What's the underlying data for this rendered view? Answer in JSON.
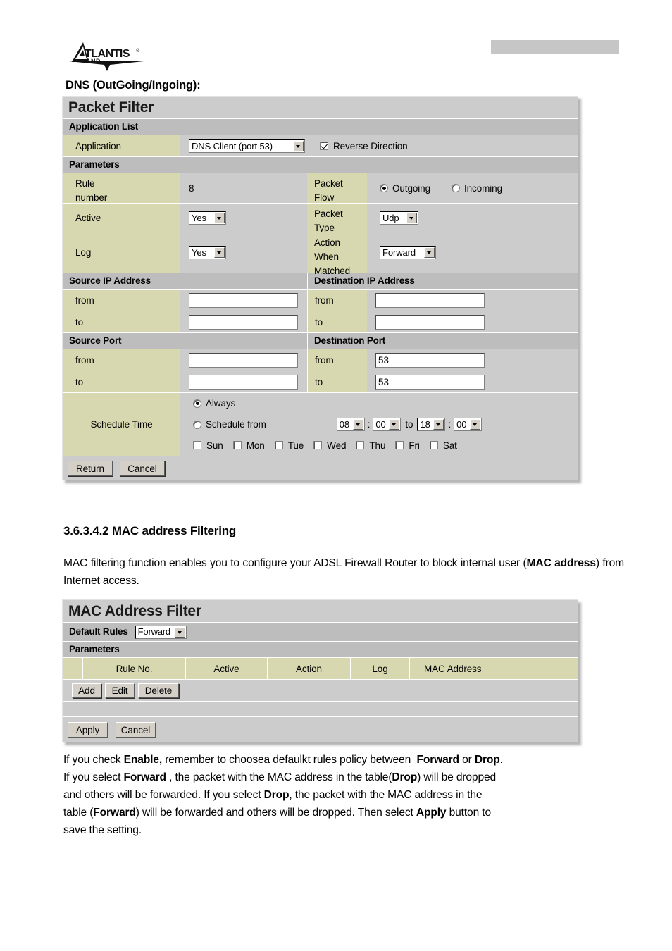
{
  "header": {
    "logo_alt": "Atlantis Land",
    "logo_primary": "TLANTIS",
    "logo_secondary": "AND",
    "logo_registered": "®"
  },
  "dns_caption": "DNS (OutGoing/Ingoing):",
  "packet_filter": {
    "title": "Packet Filter",
    "application_list_bar": "Application List",
    "application_label": "Application",
    "application_value": "DNS Client (port 53)",
    "reverse_direction_label": "Reverse Direction",
    "reverse_direction_checked": true,
    "parameters_bar": "Parameters",
    "rule_number_label": "Rule number",
    "rule_number_value": "8",
    "packet_flow_label": "Packet Flow",
    "packet_flow_outgoing": "Outgoing",
    "packet_flow_incoming": "Incoming",
    "packet_flow_selected": "Outgoing",
    "active_label": "Active",
    "active_value": "Yes",
    "packet_type_label": "Packet Type",
    "packet_type_value": "Udp",
    "log_label": "Log",
    "log_value": "Yes",
    "action_when_matched_label": "Action When Matched",
    "action_when_matched_value": "Forward",
    "source_ip_bar": "Source IP Address",
    "destination_ip_bar": "Destination IP Address",
    "source_ip_from_label": "from",
    "source_ip_from_value": "",
    "source_ip_to_label": "to",
    "source_ip_to_value": "",
    "dest_ip_from_label": "from",
    "dest_ip_from_value": "",
    "dest_ip_to_label": "to",
    "dest_ip_to_value": "",
    "source_port_bar": "Source Port",
    "destination_port_bar": "Destination Port",
    "source_port_from_label": "from",
    "source_port_from_value": "",
    "source_port_to_label": "to",
    "source_port_to_value": "",
    "dest_port_from_label": "from",
    "dest_port_from_value": "53",
    "dest_port_to_label": "to",
    "dest_port_to_value": "53",
    "schedule_time_label": "Schedule Time",
    "always_label": "Always",
    "always_selected": true,
    "schedule_from_label": "Schedule from",
    "schedule_from_selected": false,
    "schedule_start_hour": "08",
    "schedule_start_min": "00",
    "schedule_to_label": "to",
    "schedule_end_hour": "18",
    "schedule_end_min": "00",
    "time_colon": ":",
    "days": [
      {
        "label": "Sun",
        "checked": false
      },
      {
        "label": "Mon",
        "checked": false
      },
      {
        "label": "Tue",
        "checked": false
      },
      {
        "label": "Wed",
        "checked": false
      },
      {
        "label": "Thu",
        "checked": false
      },
      {
        "label": "Fri",
        "checked": false
      },
      {
        "label": "Sat",
        "checked": false
      }
    ],
    "return_button": "Return",
    "cancel_button": "Cancel"
  },
  "mac_section": {
    "heading": "3.6.3.4.2 MAC address Filtering",
    "intro_part1": "MAC filtering function enables you to configure your ADSL Firewall Router to block internal user (",
    "intro_bold": "MAC address",
    "intro_part2": ") from Internet access."
  },
  "mac_filter": {
    "title": "MAC Address Filter",
    "default_rules_label": "Default Rules",
    "default_rules_value": "Forward",
    "parameters_bar": "Parameters",
    "columns": [
      "",
      "Rule No.",
      "Active",
      "Action",
      "Log",
      "MAC Address"
    ],
    "rows": [],
    "add_button": "Add",
    "edit_button": "Edit",
    "delete_button": "Delete",
    "apply_button": "Apply",
    "cancel_button": "Cancel"
  },
  "footer_text": {
    "l1a": "If you check ",
    "l1b": "Enable,",
    "l1c": " remember to choosea defaulkt rules policy between  ",
    "l1d": "Forward",
    "l1e": " or ",
    "l1f": "Drop",
    "l1g": ".",
    "l2a": "If you select ",
    "l2b": "Forward",
    "l2c": " , the packet with the MAC address in the table(",
    "l2d": "Drop",
    "l2e": ") will be dropped",
    "l3a": "and others will be forwarded. If you select ",
    "l3b": "Drop",
    "l3c": ", the packet with the MAC address in the",
    "l4a": "table (",
    "l4b": "Forward",
    "l4c": ") will be forwarded and others will be dropped. Then select ",
    "l4d": "Apply",
    "l4e": " button to",
    "l5a": "save the setting."
  },
  "colors": {
    "panel_bg": "#cccccc",
    "bar_bg": "#bdbdbd",
    "label_khaki": "#d8d8b0",
    "header_bar": "#c6c6c6",
    "button_face": "#d4d0c8"
  }
}
